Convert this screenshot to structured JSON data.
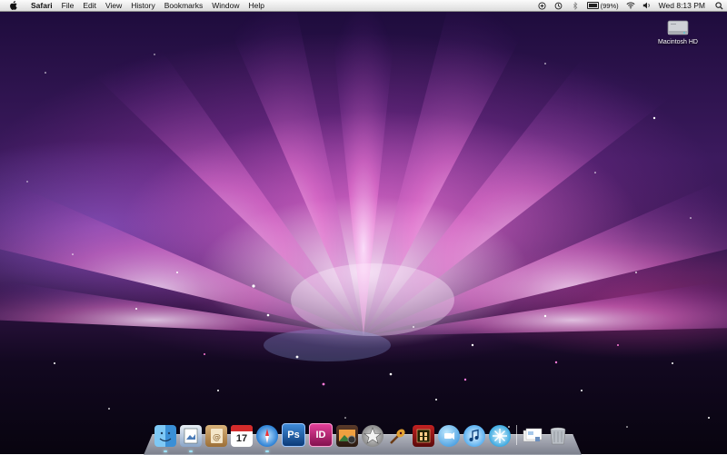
{
  "menubar": {
    "app_name": "Safari",
    "items": [
      "File",
      "Edit",
      "View",
      "History",
      "Bookmarks",
      "Window",
      "Help"
    ],
    "status_icons": [
      "sync-icon",
      "time-machine-icon",
      "bluetooth-icon",
      "battery-icon",
      "wifi-icon",
      "volume-icon"
    ],
    "battery_text": "(99%)",
    "battery_level": 0.99,
    "clock": "Wed 8:13 PM",
    "spotlight_icon": "magnifier-icon"
  },
  "desktop": {
    "hd_label": "Macintosh HD"
  },
  "dock": {
    "items": [
      {
        "name": "finder-icon",
        "running": true
      },
      {
        "name": "preview-icon",
        "running": true
      },
      {
        "name": "address-book-icon",
        "running": false
      },
      {
        "name": "ical-icon",
        "running": false
      },
      {
        "name": "safari-icon",
        "running": true
      },
      {
        "name": "photoshop-icon",
        "running": false
      },
      {
        "name": "indesign-icon",
        "running": false
      },
      {
        "name": "iphoto-icon",
        "running": false
      },
      {
        "name": "imovie-icon",
        "running": false
      },
      {
        "name": "garageband-icon",
        "running": false
      },
      {
        "name": "photo-booth-icon",
        "running": false
      },
      {
        "name": "ichat-icon",
        "running": false
      },
      {
        "name": "itunes-icon",
        "running": false
      },
      {
        "name": "network-utility-icon",
        "running": false
      },
      {
        "name": "documents-stack-icon",
        "running": false
      },
      {
        "name": "trash-icon",
        "running": false
      }
    ],
    "calendar_day": "17",
    "photoshop_label": "Ps",
    "indesign_label": "ID"
  }
}
